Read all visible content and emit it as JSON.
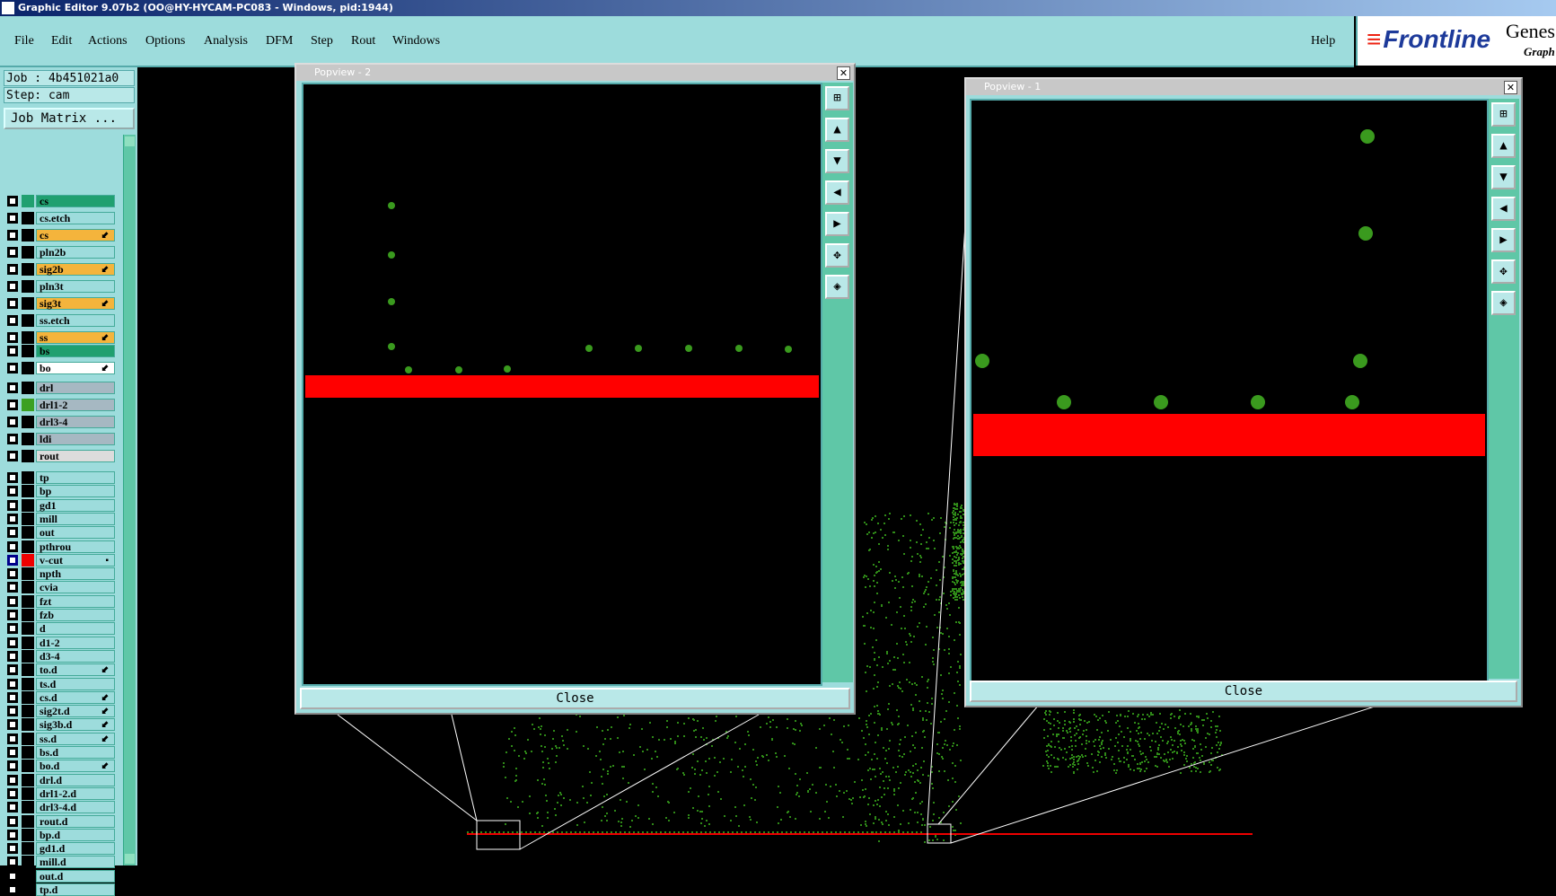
{
  "title": "Graphic Editor 9.07b2 (OO@HY-HYCAM-PC083 - Windows, pid:1944)",
  "menu": [
    "File",
    "Edit",
    "Actions",
    "Options",
    "Analysis",
    "DFM",
    "Step",
    "Rout",
    "Windows"
  ],
  "help": "Help",
  "logo": {
    "brand": "Frontline",
    "gene": "Genes",
    "grap": "Graph"
  },
  "job": "Job : 4b451021a0",
  "step": "Step: cam",
  "job_matrix": "Job Matrix ...",
  "layers": [
    {
      "name": "cs",
      "color": "#20a070",
      "bg": "#20a070",
      "mark": ""
    },
    {
      "name": "cs.etch",
      "color": "#000",
      "bg": "#9ddcdc",
      "mark": ""
    },
    {
      "name": "cs",
      "color": "#000",
      "bg": "#f4b43c",
      "mark": "⬋"
    },
    {
      "name": "pln2b",
      "color": "#000",
      "bg": "#9ddcdc",
      "mark": ""
    },
    {
      "name": "sig2b",
      "color": "#000",
      "bg": "#f4b43c",
      "mark": "⬋"
    },
    {
      "name": "pln3t",
      "color": "#000",
      "bg": "#9ddcdc",
      "mark": ""
    },
    {
      "name": "sig3t",
      "color": "#000",
      "bg": "#f4b43c",
      "mark": "⬋"
    },
    {
      "name": "ss.etch",
      "color": "#000",
      "bg": "#9ddcdc",
      "mark": ""
    },
    {
      "name": "ss",
      "color": "#000",
      "bg": "#f4b43c",
      "mark": "⬋"
    },
    {
      "name": "bs",
      "color": "#000",
      "bg": "#20a070",
      "mark": ""
    },
    {
      "name": "bo",
      "color": "#000",
      "bg": "#ffffff",
      "mark": "⬋"
    },
    {
      "name": "drl",
      "color": "#000",
      "bg": "#a6b8c2",
      "mark": ""
    },
    {
      "name": "drl1-2",
      "color": "#3ca022",
      "bg": "#a6b8c2",
      "mark": ""
    },
    {
      "name": "drl3-4",
      "color": "#000",
      "bg": "#a6b8c2",
      "mark": ""
    },
    {
      "name": "ldi",
      "color": "#000",
      "bg": "#a6b8c2",
      "mark": ""
    },
    {
      "name": "rout",
      "color": "#000",
      "bg": "#dcdcdc",
      "mark": ""
    },
    {
      "name": "tp",
      "color": "#000",
      "bg": "#9ddcdc",
      "mark": ""
    },
    {
      "name": "bp",
      "color": "#000",
      "bg": "#9ddcdc",
      "mark": ""
    },
    {
      "name": "gd1",
      "color": "#000",
      "bg": "#9ddcdc",
      "mark": ""
    },
    {
      "name": "mill",
      "color": "#000",
      "bg": "#9ddcdc",
      "mark": ""
    },
    {
      "name": "out",
      "color": "#000",
      "bg": "#9ddcdc",
      "mark": ""
    },
    {
      "name": "pthrou",
      "color": "#000",
      "bg": "#9ddcdc",
      "mark": ""
    },
    {
      "name": "v-cut",
      "color": "#e00",
      "bg": "#9ddcdc",
      "mark": "▪"
    },
    {
      "name": "npth",
      "color": "#000",
      "bg": "#9ddcdc",
      "mark": ""
    },
    {
      "name": "cvia",
      "color": "#000",
      "bg": "#9ddcdc",
      "mark": ""
    },
    {
      "name": "fzt",
      "color": "#000",
      "bg": "#9ddcdc",
      "mark": ""
    },
    {
      "name": "fzb",
      "color": "#000",
      "bg": "#9ddcdc",
      "mark": ""
    },
    {
      "name": "d",
      "color": "#000",
      "bg": "#9ddcdc",
      "mark": ""
    },
    {
      "name": "d1-2",
      "color": "#000",
      "bg": "#9ddcdc",
      "mark": ""
    },
    {
      "name": "d3-4",
      "color": "#000",
      "bg": "#9ddcdc",
      "mark": ""
    },
    {
      "name": "to.d",
      "color": "#000",
      "bg": "#9ddcdc",
      "mark": "⬋"
    },
    {
      "name": "ts.d",
      "color": "#000",
      "bg": "#9ddcdc",
      "mark": ""
    },
    {
      "name": "cs.d",
      "color": "#000",
      "bg": "#9ddcdc",
      "mark": "⬋"
    },
    {
      "name": "sig2t.d",
      "color": "#000",
      "bg": "#9ddcdc",
      "mark": "⬋"
    },
    {
      "name": "sig3b.d",
      "color": "#000",
      "bg": "#9ddcdc",
      "mark": "⬋"
    },
    {
      "name": "ss.d",
      "color": "#000",
      "bg": "#9ddcdc",
      "mark": "⬋"
    },
    {
      "name": "bs.d",
      "color": "#000",
      "bg": "#9ddcdc",
      "mark": ""
    },
    {
      "name": "bo.d",
      "color": "#000",
      "bg": "#9ddcdc",
      "mark": "⬋"
    },
    {
      "name": "drl.d",
      "color": "#000",
      "bg": "#9ddcdc",
      "mark": ""
    },
    {
      "name": "drl1-2.d",
      "color": "#000",
      "bg": "#9ddcdc",
      "mark": ""
    },
    {
      "name": "drl3-4.d",
      "color": "#000",
      "bg": "#9ddcdc",
      "mark": ""
    },
    {
      "name": "rout.d",
      "color": "#000",
      "bg": "#9ddcdc",
      "mark": ""
    },
    {
      "name": "bp.d",
      "color": "#000",
      "bg": "#9ddcdc",
      "mark": ""
    },
    {
      "name": "gd1.d",
      "color": "#000",
      "bg": "#9ddcdc",
      "mark": ""
    },
    {
      "name": "mill.d",
      "color": "#000",
      "bg": "#9ddcdc",
      "mark": ""
    },
    {
      "name": "out.d",
      "color": "#000",
      "bg": "#9ddcdc",
      "mark": ""
    },
    {
      "name": "tp.d",
      "color": "#000",
      "bg": "#9ddcdc",
      "mark": ""
    }
  ],
  "popview2": {
    "title": "Popview - 2",
    "close": "Close"
  },
  "popview1": {
    "title": "Popview - 1",
    "close": "Close"
  },
  "tool_icons": [
    "zoom-window-icon",
    "pan-up-icon",
    "pan-down-icon",
    "pan-left-icon",
    "pan-right-icon",
    "zoom-fit-icon",
    "zoom-center-icon"
  ]
}
